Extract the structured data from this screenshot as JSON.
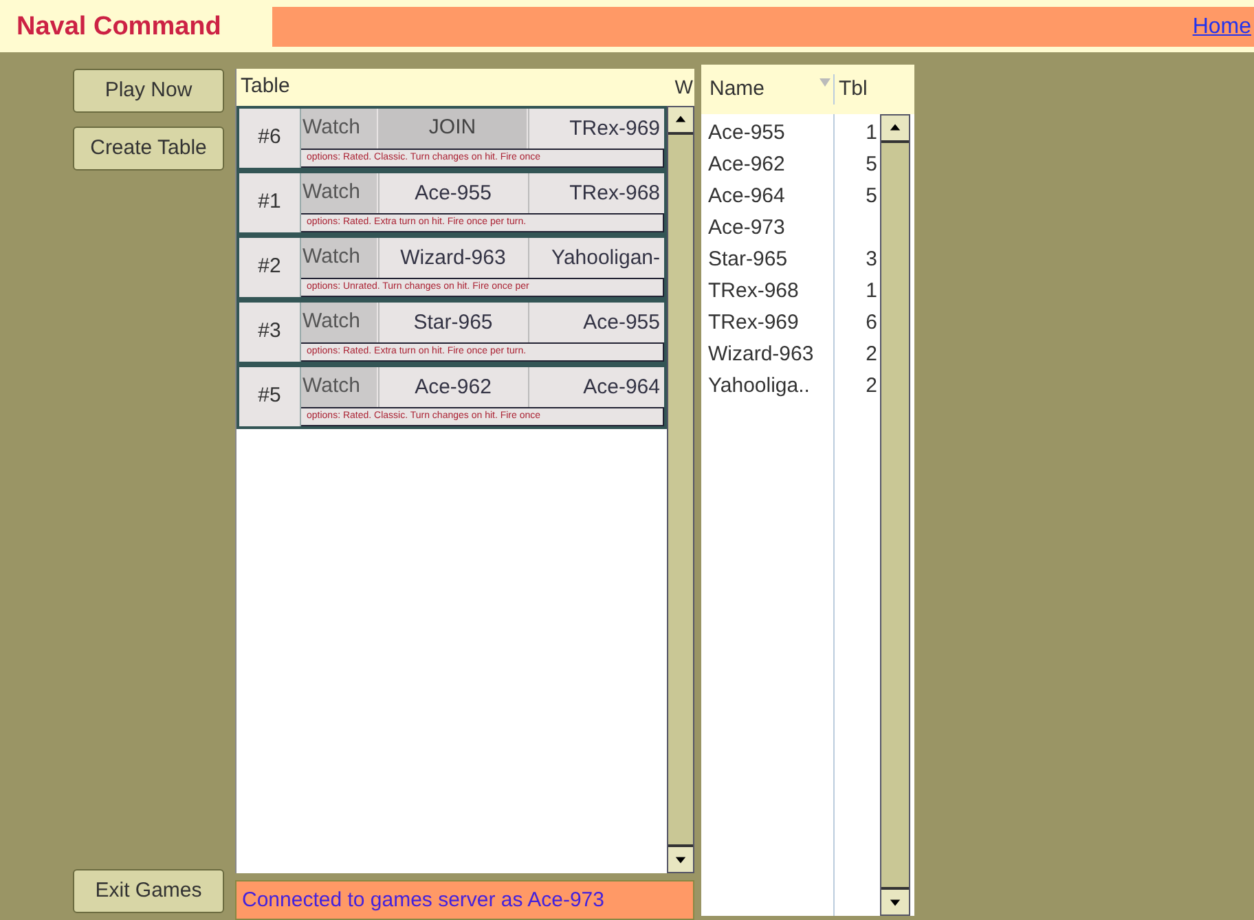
{
  "header": {
    "title": "Naval Command",
    "link": "Home"
  },
  "buttons": [
    {
      "label": "Play Now"
    },
    {
      "label": "Create Table"
    }
  ],
  "exit_button": {
    "label": "Exit Games"
  },
  "tables": {
    "columns": [
      "Table",
      "W"
    ],
    "rows": [
      {
        "number": "#6",
        "watch": "Watch",
        "seats": [
          {
            "kind": "join",
            "text": "JOIN"
          },
          {
            "kind": "player",
            "text": "TRex-969"
          }
        ],
        "options": "options:  Rated. Classic. Turn changes on hit. Fire once"
      },
      {
        "number": "#1",
        "watch": "Watch",
        "seats": [
          {
            "kind": "player",
            "text": "Ace-955"
          },
          {
            "kind": "player",
            "text": "TRex-968"
          }
        ],
        "options": "options:  Rated. Extra turn on hit. Fire once per turn."
      },
      {
        "number": "#2",
        "watch": "Watch",
        "seats": [
          {
            "kind": "player",
            "text": "Wizard-963"
          },
          {
            "kind": "player",
            "text": "Yahooligan-"
          }
        ],
        "options": "options:  Unrated. Turn changes on hit. Fire once per"
      },
      {
        "number": "#3",
        "watch": "Watch",
        "seats": [
          {
            "kind": "player",
            "text": "Star-965"
          },
          {
            "kind": "player",
            "text": "Ace-955"
          }
        ],
        "options": "options:  Rated. Extra turn on hit. Fire once per turn."
      },
      {
        "number": "#5",
        "watch": "Watch",
        "seats": [
          {
            "kind": "player",
            "text": "Ace-962"
          },
          {
            "kind": "player",
            "text": "Ace-964"
          }
        ],
        "options": "options:  Rated. Classic. Turn changes on hit. Fire once"
      }
    ]
  },
  "status": "Connected to games server as Ace-973",
  "players": {
    "columns": [
      "Name",
      "Tbl"
    ],
    "rows": [
      {
        "name": "Ace-955",
        "tbl": "1"
      },
      {
        "name": "Ace-962",
        "tbl": "5"
      },
      {
        "name": "Ace-964",
        "tbl": "5"
      },
      {
        "name": "Ace-973"
      },
      {
        "name": "Star-965",
        "tbl": "3"
      },
      {
        "name": "TRex-968",
        "tbl": "1"
      },
      {
        "name": "TRex-969",
        "tbl": "6"
      },
      {
        "name": "Wizard-963",
        "tbl": "2"
      },
      {
        "name": "Yahooliga..",
        "tbl": "2"
      }
    ]
  }
}
